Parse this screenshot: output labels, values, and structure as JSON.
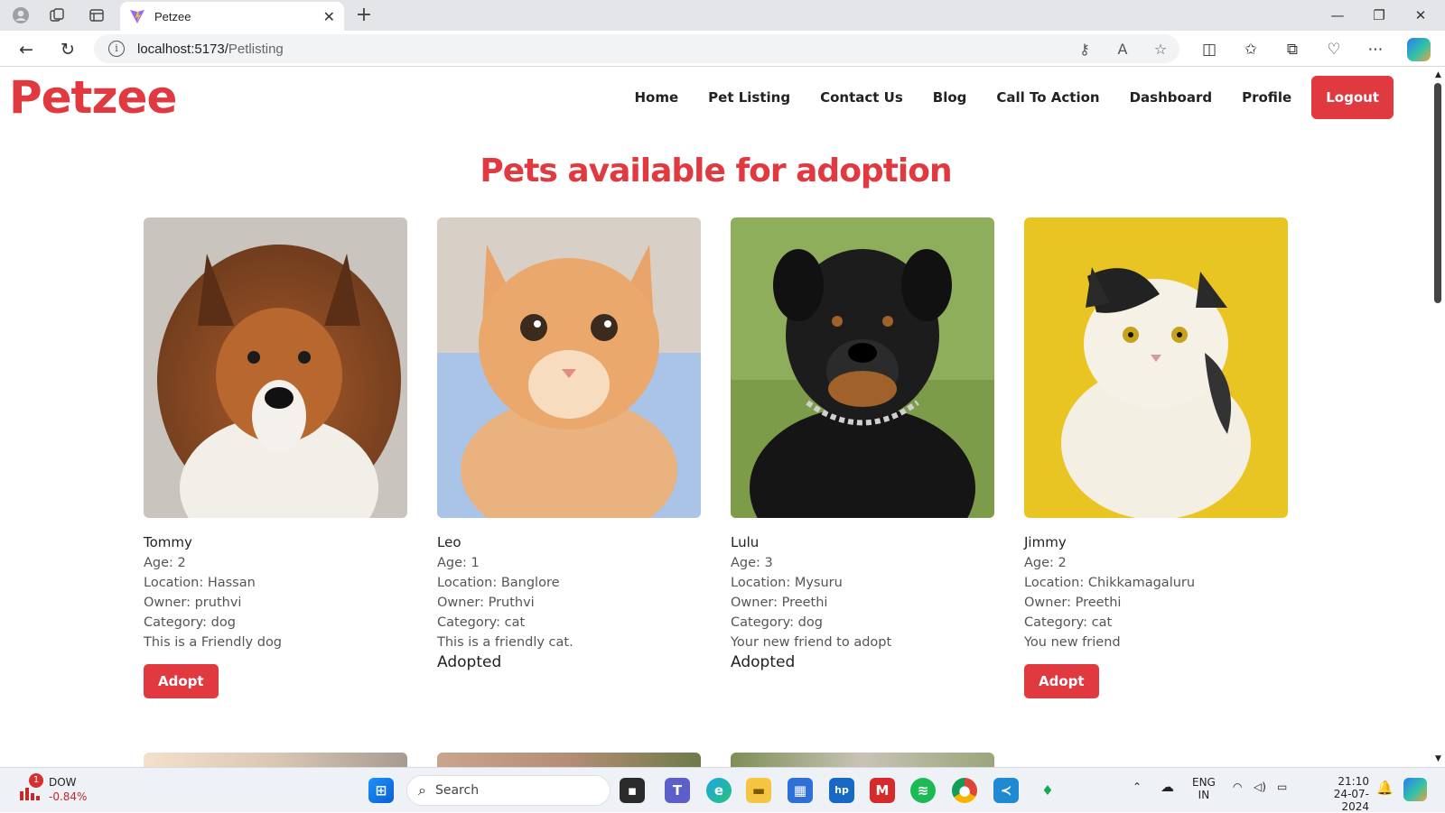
{
  "browser": {
    "tab_title": "Petzee",
    "url_host": "localhost:5173/",
    "url_path": "Petlisting"
  },
  "site": {
    "logo": "Petzee",
    "nav": [
      "Home",
      "Pet Listing",
      "Contact Us",
      "Blog",
      "Call To Action",
      "Dashboard",
      "Profile"
    ],
    "logout": "Logout",
    "heading": "Pets available for adoption"
  },
  "pets": [
    {
      "name": "Tommy",
      "age": "Age: 2",
      "location": "Location: Hassan",
      "owner": "Owner: pruthvi",
      "category": "Category: dog",
      "description": "This is a Friendly dog",
      "action": "Adopt"
    },
    {
      "name": "Leo",
      "age": "Age: 1",
      "location": "Location: Banglore",
      "owner": "Owner: Pruthvi",
      "category": "Category: cat",
      "description": "This is a friendly cat.",
      "status": "Adopted"
    },
    {
      "name": "Lulu",
      "age": "Age: 3",
      "location": "Location: Mysuru",
      "owner": "Owner: Preethi",
      "category": "Category: dog",
      "description": "Your new friend to adopt",
      "status": "Adopted"
    },
    {
      "name": "Jimmy",
      "age": "Age: 2",
      "location": "Location: Chikkamagaluru",
      "owner": "Owner: Preethi",
      "category": "Category: cat",
      "description": "You new friend",
      "action": "Adopt"
    }
  ],
  "taskbar": {
    "stock_badge": "1",
    "stock_name": "DOW",
    "stock_change": "-0.84%",
    "search_placeholder": "Search",
    "lang_1": "ENG",
    "lang_2": "IN",
    "time": "21:10",
    "date": "24-07-2024"
  },
  "colors": {
    "brand_red": "#e0393f"
  }
}
